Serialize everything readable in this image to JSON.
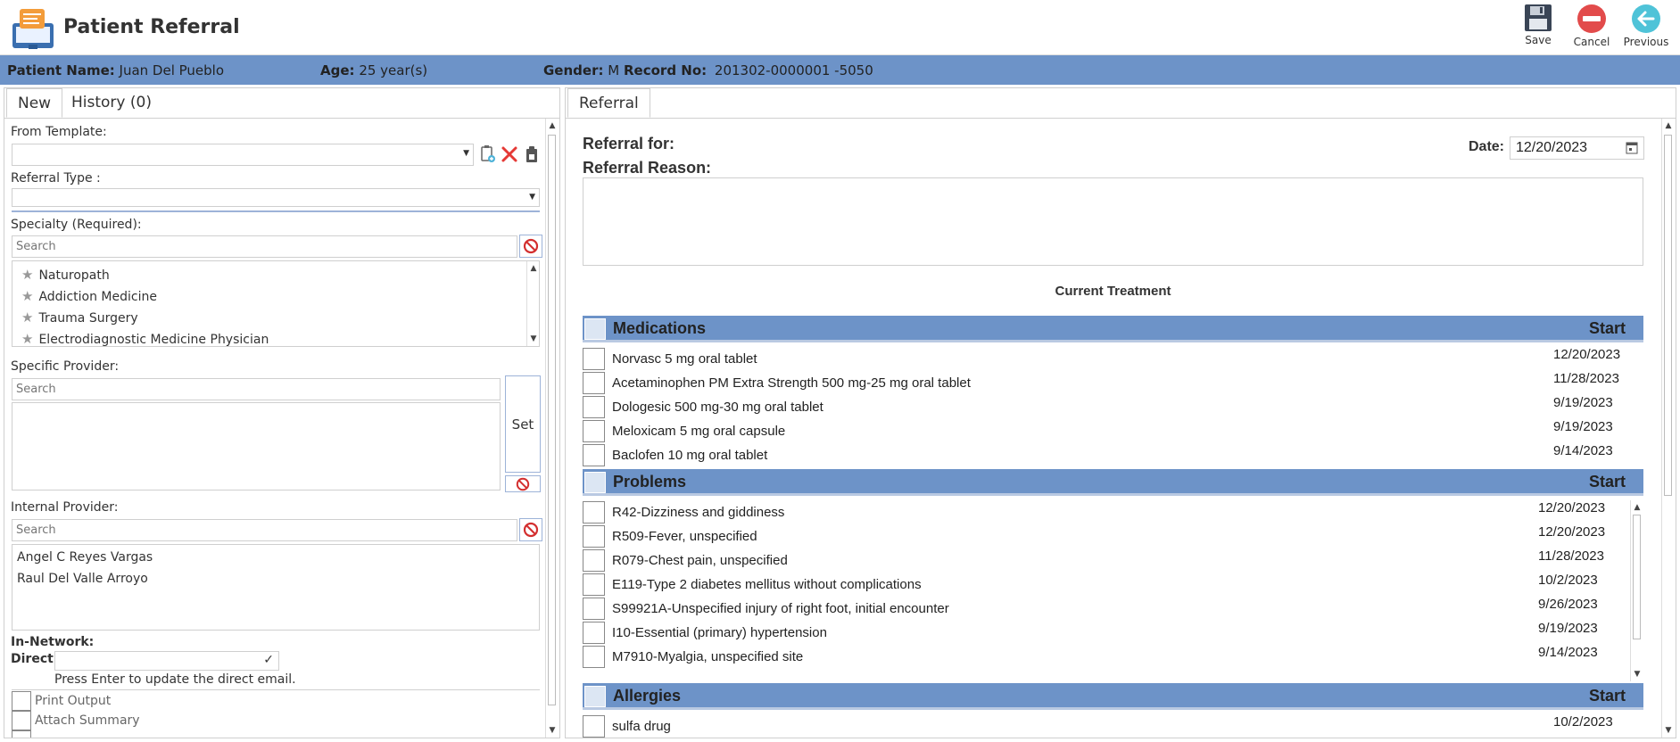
{
  "header": {
    "title": "Patient Referral",
    "save_label": "Save",
    "cancel_label": "Cancel",
    "previous_label": "Previous"
  },
  "patient": {
    "name_label": "Patient Name:",
    "name": "Juan Del Pueblo",
    "age_label": "Age:",
    "age": "25 year(s)",
    "gender_label": "Gender:",
    "gender": "M",
    "record_label": "Record No:",
    "record": "201302-0000001 -5050"
  },
  "left": {
    "tabs": [
      {
        "label": "New"
      },
      {
        "label": "History (0)"
      }
    ],
    "from_template_label": "From Template:",
    "referral_type_label": "Referral Type :",
    "specialty_label": "Specialty (Required):",
    "specialty_search_placeholder": "Search",
    "specialties": [
      "Naturopath",
      "Addiction Medicine",
      "Trauma Surgery",
      "Electrodiagnostic Medicine Physician"
    ],
    "specific_provider_label": "Specific Provider:",
    "specific_provider_placeholder": "Search",
    "set_label": "Set",
    "internal_provider_label": "Internal Provider:",
    "internal_provider_placeholder": "Search",
    "internal_providers": [
      "Angel C Reyes Vargas",
      "Raul Del Valle Arroyo"
    ],
    "in_network_label": "In-Network:",
    "direct_label": "Direct:",
    "direct_hint": "Press Enter to update the direct email.",
    "options": [
      "Print Output",
      "Attach Summary"
    ]
  },
  "right": {
    "tab_label": "Referral",
    "referral_for_label": "Referral for:",
    "referral_reason_label": "Referral Reason:",
    "date_label": "Date:",
    "date_value": "12/20/2023",
    "current_treatment_label": "Current Treatment",
    "start_label": "Start",
    "medications_label": "Medications",
    "medications": [
      {
        "name": "Norvasc 5 mg oral tablet",
        "start": "12/20/2023"
      },
      {
        "name": "Acetaminophen PM Extra Strength 500 mg-25 mg oral tablet",
        "start": "11/28/2023"
      },
      {
        "name": "Dologesic 500 mg-30 mg oral tablet",
        "start": "9/19/2023"
      },
      {
        "name": "Meloxicam 5 mg oral capsule",
        "start": "9/19/2023"
      },
      {
        "name": "Baclofen 10 mg oral tablet",
        "start": "9/14/2023"
      }
    ],
    "problems_label": "Problems",
    "problems": [
      {
        "name": "R42-Dizziness and giddiness",
        "start": "12/20/2023"
      },
      {
        "name": "R509-Fever, unspecified",
        "start": "12/20/2023"
      },
      {
        "name": "R079-Chest pain, unspecified",
        "start": "11/28/2023"
      },
      {
        "name": "E119-Type 2 diabetes mellitus without complications",
        "start": "10/2/2023"
      },
      {
        "name": "S99921A-Unspecified injury of right foot, initial encounter",
        "start": "9/26/2023"
      },
      {
        "name": "I10-Essential (primary) hypertension",
        "start": "9/19/2023"
      },
      {
        "name": "M7910-Myalgia, unspecified site",
        "start": "9/14/2023"
      }
    ],
    "allergies_label": "Allergies",
    "allergies": [
      {
        "name": "sulfa drug",
        "start": "10/2/2023"
      }
    ]
  },
  "colors": {
    "accent_bar": "#6d93c8",
    "cancel_red": "#e24b4b",
    "previous_teal": "#4fc3d8"
  }
}
